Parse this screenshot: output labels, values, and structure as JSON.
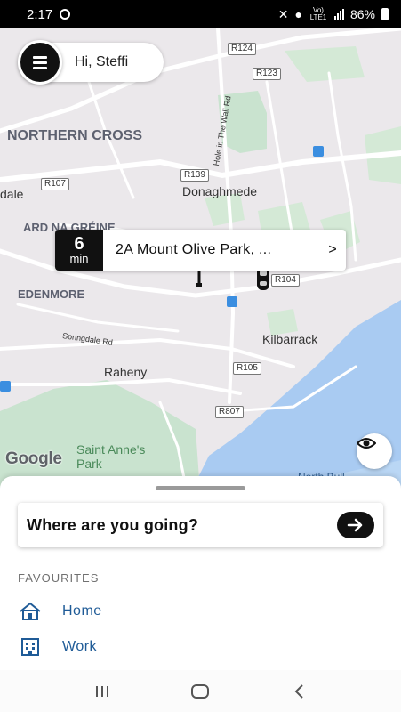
{
  "status_bar": {
    "time": "2:17",
    "battery": "86%",
    "network": "Vo) LTE1"
  },
  "header": {
    "greeting": "Hi, Steffi"
  },
  "map": {
    "road_labels": [
      "R124",
      "R123",
      "R139",
      "R107",
      "R104",
      "R105",
      "R807"
    ],
    "area_labels": [
      "NORTHERN CROSS",
      "ARD NA GRÉINE",
      "EDENMORE"
    ],
    "place_labels": [
      "Donaghmede",
      "Kilbarrack",
      "Raheny",
      "dale",
      "Saint Anne's Park",
      "Springdale Rd",
      "Hole in The Wall Rd",
      "North Bull"
    ],
    "attribution": "Google",
    "eta": {
      "minutes": "6",
      "unit": "min",
      "address": "2A Mount Olive Park, ...",
      "chevron": ">"
    }
  },
  "sheet": {
    "search_prompt": "Where are you going?",
    "favourites_title": "FAVOURITES",
    "favourites": [
      {
        "label": "Home",
        "icon": "home-icon"
      },
      {
        "label": "Work",
        "icon": "building-icon"
      }
    ]
  },
  "colors": {
    "accent": "#1f5b97",
    "dark": "#111111",
    "water": "#a9cbf2",
    "park": "#c9e3cf"
  }
}
